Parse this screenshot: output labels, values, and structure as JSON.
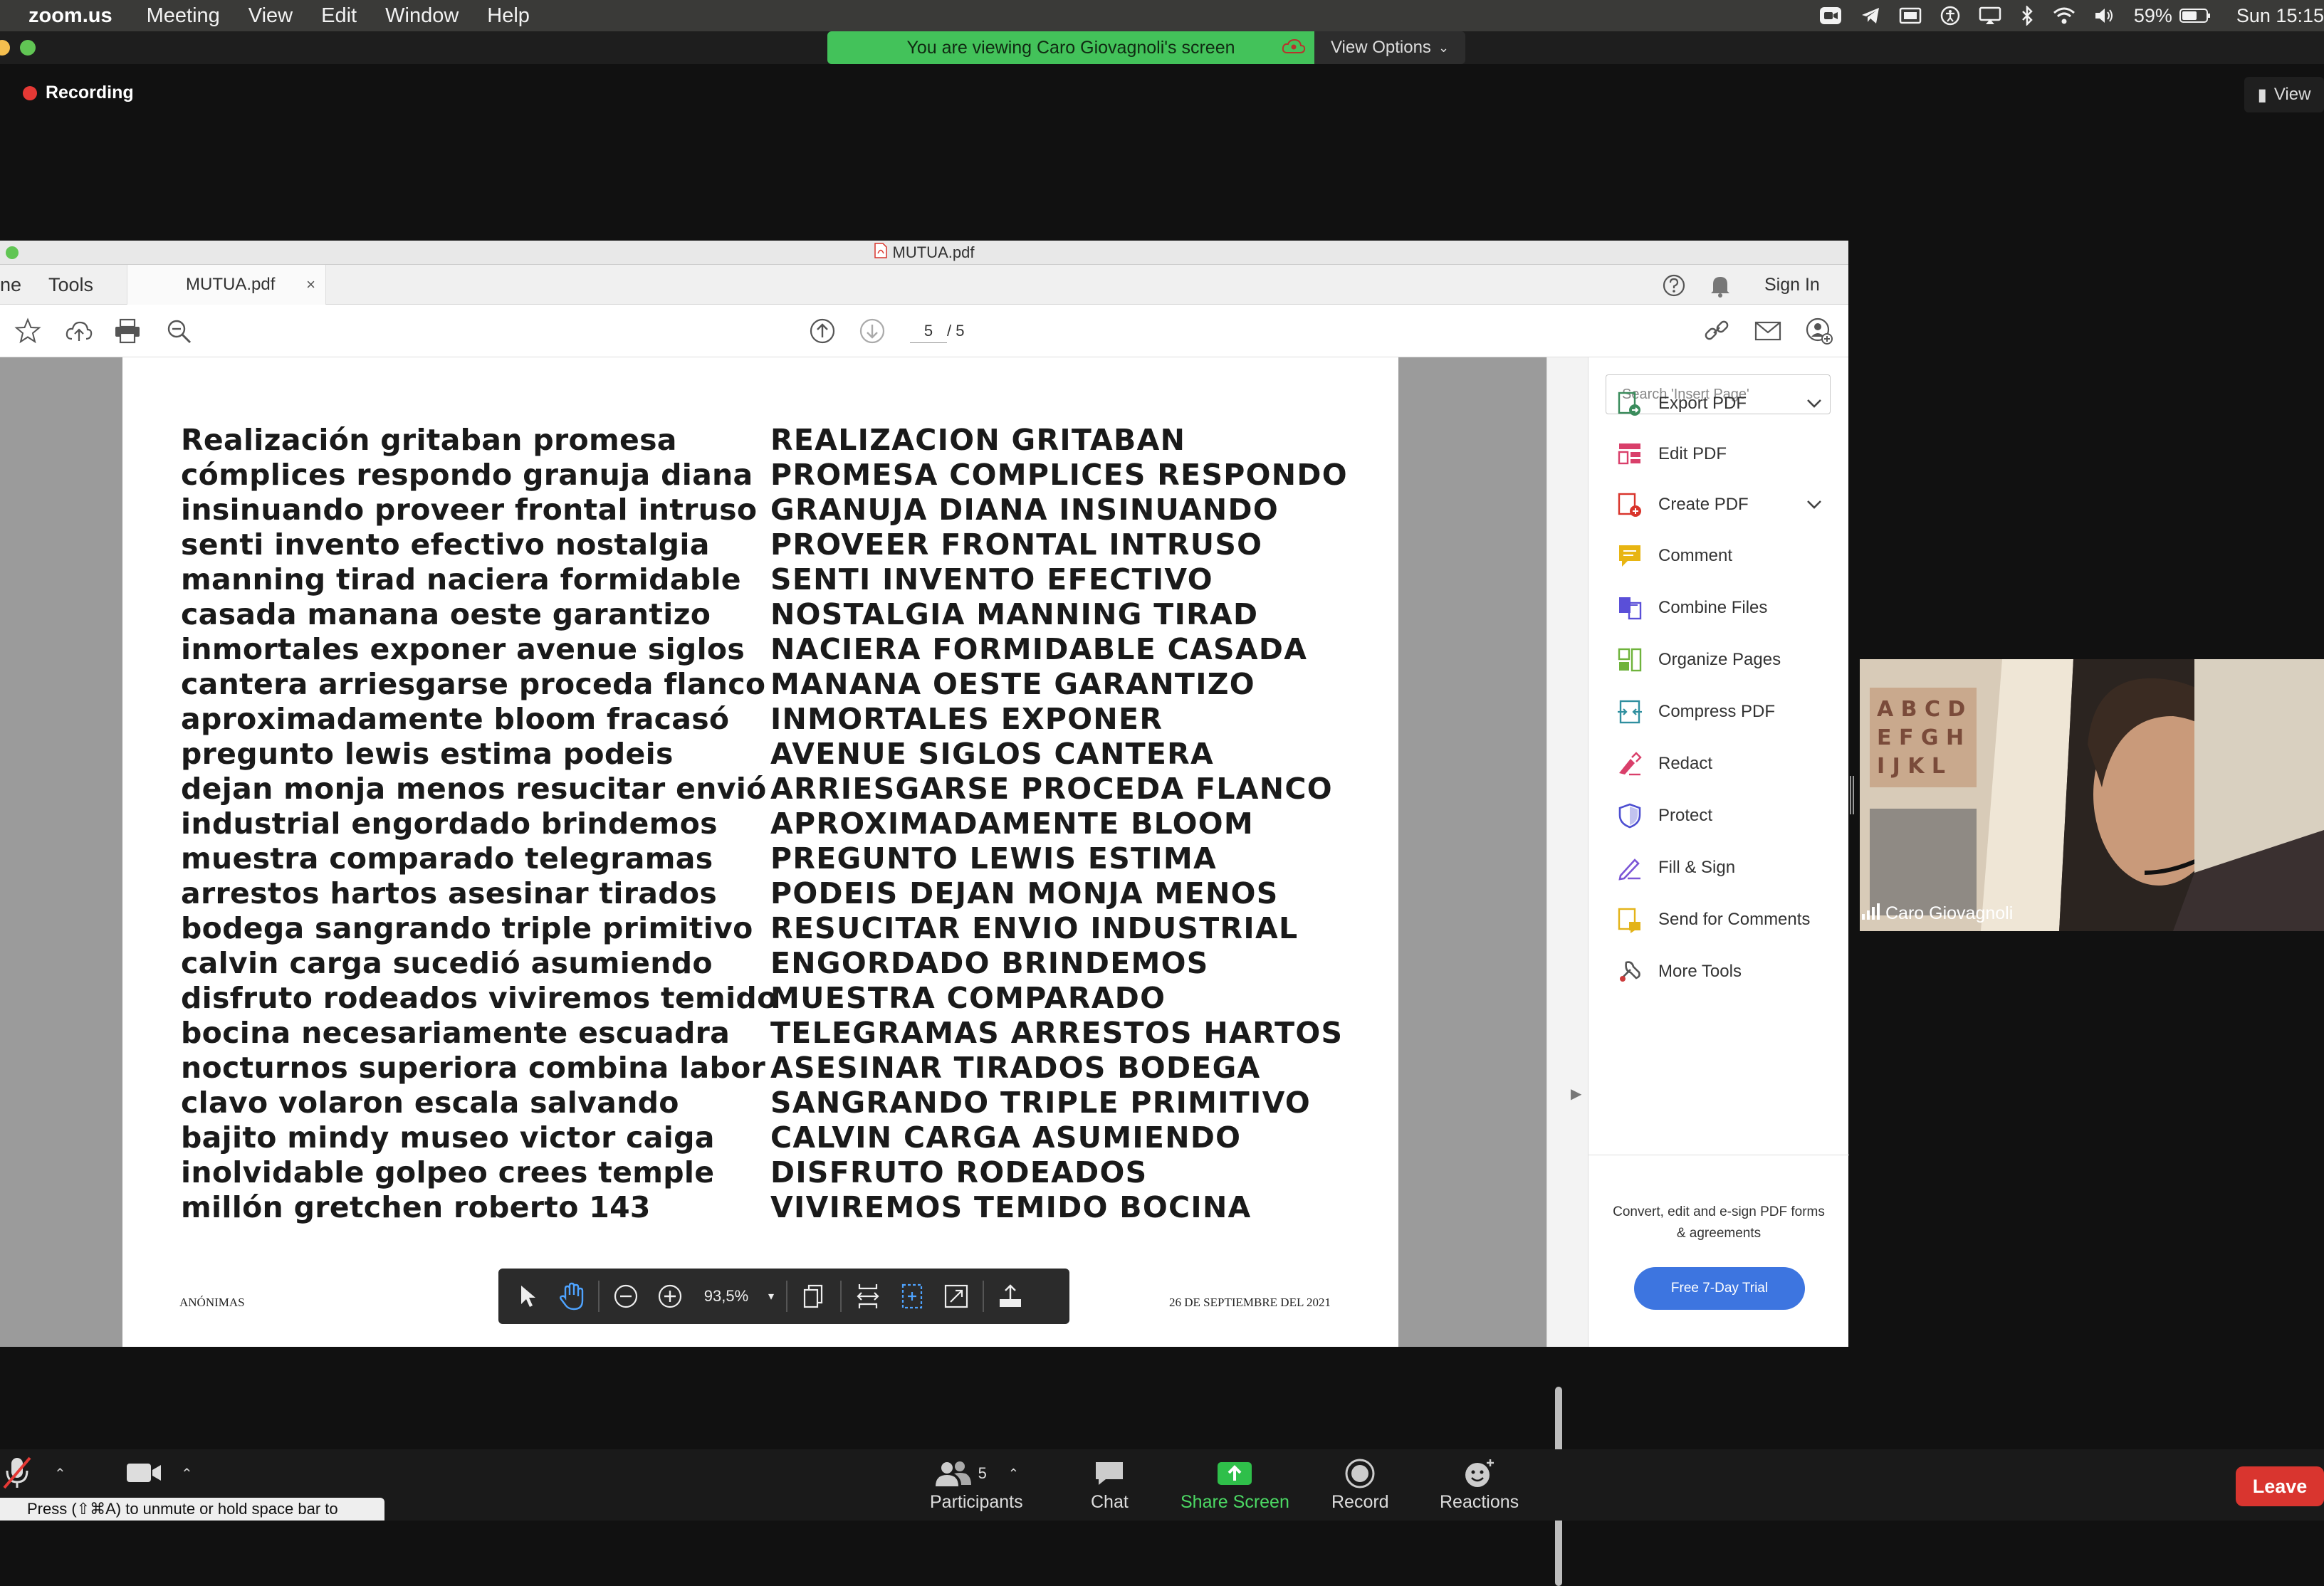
{
  "menubar": {
    "app": "zoom.us",
    "items": [
      "Meeting",
      "View",
      "Edit",
      "Window",
      "Help"
    ],
    "battery": "59%",
    "clock": "Sun 15:15"
  },
  "zoom": {
    "viewing_banner": "You are viewing Caro Giovagnoli's screen",
    "view_options": "View Options",
    "recording": "Recording",
    "view_button": "View",
    "participant_name": "Caro Giovagnoli"
  },
  "acrobat": {
    "window_title": "MUTUA.pdf",
    "tab_home": "ne",
    "tab_tools": "Tools",
    "tab_doc": "MUTUA.pdf",
    "tab_close": "×",
    "sign_in": "Sign In",
    "page_current": "5",
    "page_total": "/ 5",
    "zoom_level": "93,5%",
    "search_placeholder": "Search 'Insert Page'",
    "tools": [
      {
        "label": "Export PDF",
        "icon": "export-pdf-icon",
        "color": "#3a8c5c"
      },
      {
        "label": "Edit PDF",
        "icon": "edit-pdf-icon",
        "color": "#d93f6a"
      },
      {
        "label": "Create PDF",
        "icon": "create-pdf-icon",
        "color": "#d9342b"
      },
      {
        "label": "Comment",
        "icon": "comment-icon",
        "color": "#e8b512"
      },
      {
        "label": "Combine Files",
        "icon": "combine-files-icon",
        "color": "#5a4fd8"
      },
      {
        "label": "Organize Pages",
        "icon": "organize-pages-icon",
        "color": "#6fb33c"
      },
      {
        "label": "Compress PDF",
        "icon": "compress-pdf-icon",
        "color": "#2f8f9f"
      },
      {
        "label": "Redact",
        "icon": "redact-icon",
        "color": "#d93f6a"
      },
      {
        "label": "Protect",
        "icon": "protect-icon",
        "color": "#4d4fd1"
      },
      {
        "label": "Fill & Sign",
        "icon": "fill-sign-icon",
        "color": "#7b56d6"
      },
      {
        "label": "Send for Comments",
        "icon": "send-for-comments-icon",
        "color": "#e3b319"
      },
      {
        "label": "More Tools",
        "icon": "more-tools-icon",
        "color": "#555555"
      }
    ],
    "promo_text": "Convert, edit and e-sign PDF forms & agreements",
    "trial_button": "Free 7-Day Trial"
  },
  "document": {
    "left_column": [
      "Realización gritaban promesa",
      "cómplices respondo granuja diana",
      "insinuando proveer frontal intruso",
      "senti invento efectivo nostalgia",
      "manning tirad naciera formidable",
      "casada manana oeste garantizo",
      "inmortales exponer avenue siglos",
      "cantera arriesgarse proceda flanco",
      "aproximadamente bloom fracasó",
      "pregunto lewis estima podeis",
      "dejan monja menos resucitar envió",
      "industrial engordado brindemos",
      "muestra comparado telegramas",
      "arrestos hartos asesinar tirados",
      "bodega sangrando triple primitivo",
      "calvin carga sucedió asumiendo",
      "disfruto rodeados viviremos temido",
      "bocina necesariamente escuadra",
      "nocturnos superiora combina labor",
      "clavo volaron escala salvando",
      "bajito mindy museo victor caiga",
      "inolvidable golpeo crees temple",
      "millón gretchen roberto 143"
    ],
    "right_column": [
      "REALIZACION GRITABAN",
      "PROMESA COMPLICES RESPONDO",
      "GRANUJA DIANA INSINUANDO",
      "PROVEER FRONTAL INTRUSO",
      "SENTI INVENTO EFECTIVO",
      "NOSTALGIA MANNING TIRAD",
      "NACIERA FORMIDABLE CASADA",
      "MANANA OESTE GARANTIZO",
      "INMORTALES EXPONER",
      "AVENUE SIGLOS CANTERA",
      "ARRIESGARSE PROCEDA FLANCO",
      "APROXIMADAMENTE BLOOM",
      "PREGUNTO LEWIS ESTIMA",
      "PODEIS DEJAN MONJA MENOS",
      "RESUCITAR ENVIO INDUSTRIAL",
      "ENGORDADO BRINDEMOS",
      "MUESTRA COMPARADO",
      "TELEGRAMAS ARRESTOS HARTOS",
      "ASESINAR TIRADOS BODEGA",
      "SANGRANDO TRIPLE PRIMITIVO",
      "CALVIN CARGA ASUMIENDO",
      "DISFRUTO RODEADOS",
      "VIVIREMOS TEMIDO BOCINA"
    ],
    "footer_left": "ANÓNIMAS",
    "footer_right": "26 DE SEPTIEMBRE DEL 2021"
  },
  "controls": {
    "participants_label": "Participants",
    "participants_count": "5",
    "chat": "Chat",
    "share_screen": "Share Screen",
    "record": "Record",
    "reactions": "Reactions",
    "leave": "Leave",
    "unmute_tip": "Press  (⇧⌘A) to unmute or hold space bar to"
  }
}
